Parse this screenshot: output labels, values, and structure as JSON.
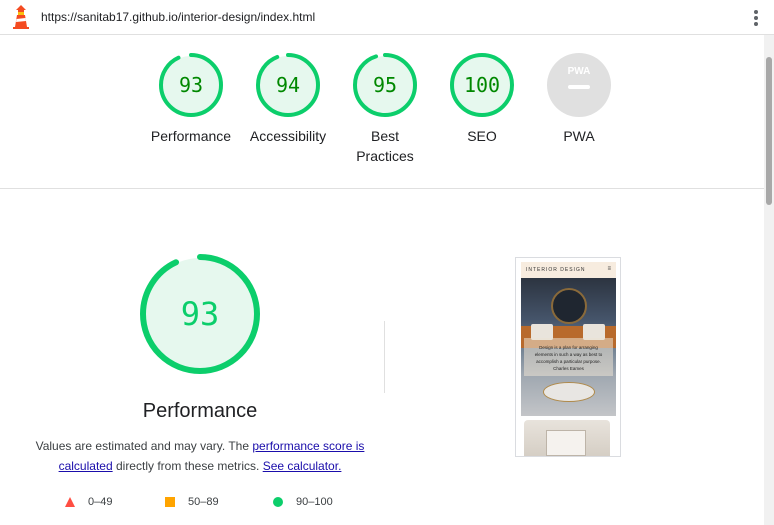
{
  "browser": {
    "url": "https://sanitab17.github.io/interior-design/index.html"
  },
  "colors": {
    "pass": "#0cce6b",
    "pass_text": "#008800",
    "pass_fill": "#e6f8ee",
    "average": "#ffa400",
    "fail": "#ff4e42",
    "na_fill": "#e0e0e0",
    "link": "#1a0dab"
  },
  "summary": [
    {
      "id": "performance",
      "label": "Performance",
      "score": "93",
      "fraction": 0.93
    },
    {
      "id": "accessibility",
      "label": "Accessibility",
      "score": "94",
      "fraction": 0.94
    },
    {
      "id": "best-practices",
      "label": "Best\nPractices",
      "score": "95",
      "fraction": 0.95
    },
    {
      "id": "seo",
      "label": "SEO",
      "score": "100",
      "fraction": 1.0
    },
    {
      "id": "pwa",
      "label": "PWA",
      "badge": "PWA",
      "score": ""
    }
  ],
  "performance": {
    "score": "93",
    "fraction": 0.93,
    "title": "Performance",
    "desc_before": "Values are estimated and may vary. The ",
    "desc_link1": "performance score is calculated",
    "desc_middle": " directly from these metrics. ",
    "desc_link2": "See calculator."
  },
  "legend": [
    {
      "icon": "triangle-icon",
      "range": "0–49"
    },
    {
      "icon": "square-icon",
      "range": "50–89"
    },
    {
      "icon": "circle-icon",
      "range": "90–100"
    }
  ],
  "screenshot": {
    "brand": "INTERIOR DESIGN",
    "menu_icon": "≡",
    "quote_lines": [
      "Design is a plan for arranging",
      "elements in such a way as best to",
      "accomplish a particular purpose.",
      "Charles Eames"
    ]
  }
}
